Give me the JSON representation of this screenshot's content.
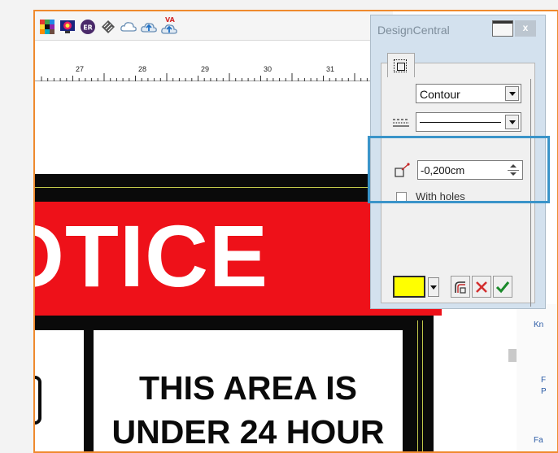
{
  "ruler": {
    "marks": [
      "27",
      "28",
      "29",
      "30",
      "31"
    ]
  },
  "toolbar": {
    "icons": [
      "color-palette-icon",
      "color-wheel-icon",
      "er-badge-icon",
      "diamond-stripes-icon",
      "cloud-icon",
      "cloud-upload-icon",
      "cloud-upload-va-icon"
    ],
    "va_label": "VA"
  },
  "sign": {
    "header_text": "OTICE",
    "body_line1": "THIS AREA IS",
    "body_line2": "UNDER 24 HOUR"
  },
  "side_links": [
    "Kn",
    "F",
    "P",
    "Fa"
  ],
  "panel": {
    "title": "DesignCentral",
    "close_label": "x",
    "mode_select": {
      "value": "Contour"
    },
    "offset_field": {
      "value": "-0,200cm"
    },
    "with_holes": {
      "label": "With holes",
      "checked": false
    },
    "fill_color": "#ffff00",
    "highlight_color": "#3a94c9"
  }
}
